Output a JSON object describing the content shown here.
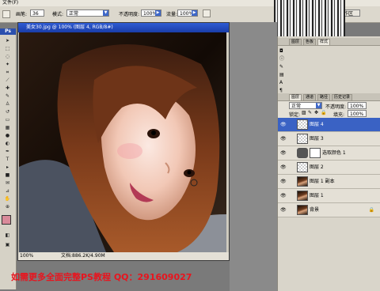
{
  "menu": [
    "文件(F)"
  ],
  "options": {
    "mode_label": "画笔:",
    "brush_size": "36",
    "blend_label": "模式:",
    "blend_value": "正常",
    "opacity_label": "不透明度:",
    "opacity_value": "100%",
    "flow_label": "流量:",
    "flow_value": "100%",
    "workspace_label": "工作区"
  },
  "toolbox": {
    "header": "Ps"
  },
  "document": {
    "title": "美女30.jpg @ 100% (图层 4, RGB/8#)",
    "zoom": "100%",
    "doc_size": "文档:886.2K/4.90M"
  },
  "right_panels": {
    "row1_tabs": [
      "图层",
      "色板",
      "样式"
    ],
    "row2_tabs": [
      "图层",
      "通道",
      "路径",
      "历史记录"
    ],
    "blend_mode": "正常",
    "opacity_label": "不透明度:",
    "opacity_value": "100%",
    "lock_label": "锁定:",
    "fill_label": "填充:",
    "fill_value": "100%"
  },
  "layers": [
    {
      "name": "图层 4",
      "thumb": "checker",
      "selected": true,
      "locked": false
    },
    {
      "name": "图层 3",
      "thumb": "checker",
      "selected": false,
      "locked": false
    },
    {
      "name": "选取颜色 1",
      "thumb": "adjust",
      "selected": false,
      "locked": false
    },
    {
      "name": "图层 2",
      "thumb": "checker",
      "selected": false,
      "locked": false
    },
    {
      "name": "图层 1 副本",
      "thumb": "photo",
      "selected": false,
      "locked": false
    },
    {
      "name": "图层 1",
      "thumb": "photo",
      "selected": false,
      "locked": false
    },
    {
      "name": "背景",
      "thumb": "photo",
      "selected": false,
      "locked": true
    }
  ],
  "promo_text": "如需更多全面完整PS教程 QQ：291609027",
  "colors": {
    "title_blue": "#2f5bd3",
    "selected_layer": "#3a62c4",
    "promo_red": "#e8141e"
  }
}
